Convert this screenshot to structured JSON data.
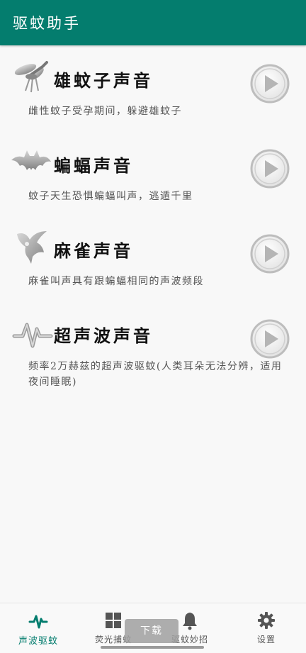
{
  "appbar": {
    "title": "驱蚊助手"
  },
  "sounds": [
    {
      "title": "雄蚊子声音",
      "desc": "雌性蚊子受孕期间，躲避雄蚊子",
      "icon": "mosquito-icon"
    },
    {
      "title": "蝙蝠声音",
      "desc": "蚊子天生恐惧蝙蝠叫声，逃遁千里",
      "icon": "bat-icon"
    },
    {
      "title": "麻雀声音",
      "desc": "麻雀叫声具有跟蝙蝠相同的声波频段",
      "icon": "sparrow-icon"
    },
    {
      "title": "超声波声音",
      "desc": "频率2万赫兹的超声波驱蚊(人类耳朵无法分辨，适用夜间睡眠)",
      "icon": "waveform-icon"
    }
  ],
  "nav": {
    "items": [
      {
        "label": "声波驱蚊",
        "icon": "pulse-icon",
        "active": true
      },
      {
        "label": "荧光捕蚊",
        "icon": "grid-icon",
        "active": false
      },
      {
        "label": "驱蚊妙招",
        "icon": "bell-icon",
        "active": false
      },
      {
        "label": "设置",
        "icon": "gear-icon",
        "active": false
      }
    ]
  },
  "toast": {
    "label": "下载"
  },
  "colors": {
    "primary": "#047d6e",
    "background": "#f8f8f8"
  }
}
